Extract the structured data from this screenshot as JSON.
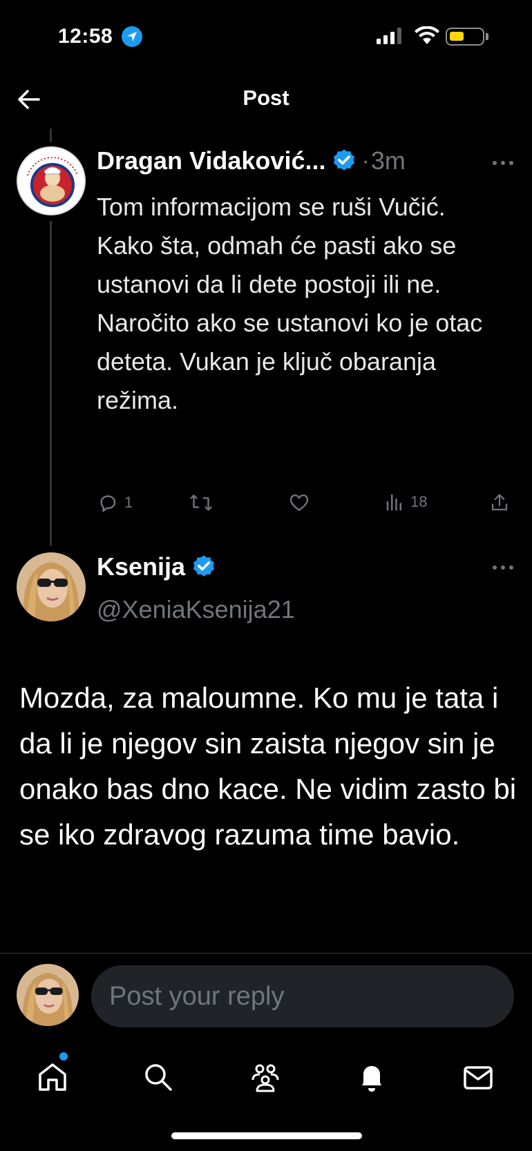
{
  "status_bar": {
    "time": "12:58"
  },
  "header": {
    "title": "Post"
  },
  "parent_post": {
    "author_name": "Dragan Vidaković...",
    "separator": "·",
    "time_ago": "3m",
    "text": "Tom informacijom se ruši Vučić. Kako šta, odmah će pasti ako se ustanovi da li dete postoji ili ne. Naročito ako se ustanovi ko je otac deteta. Vukan je ključ obaranja režima.",
    "reply_count": "1",
    "views_count": "18"
  },
  "main_post": {
    "author_name": "Ksenija",
    "handle": "@XeniaKsenija21",
    "text": "Mozda, za maloumne. Ko mu je tata i da li je njegov sin zaista njegov sin je onako bas dno kace. Ne vidim zasto bi se iko zdravog razuma time bavio."
  },
  "reply": {
    "placeholder": "Post your reply"
  },
  "colors": {
    "background": "#000000",
    "accent": "#1d9bf0",
    "muted": "#71767b",
    "input_bg": "#202327"
  },
  "icons": [
    "back-arrow-icon",
    "verified-badge-icon",
    "more-icon",
    "reply-icon",
    "repost-icon",
    "like-icon",
    "views-icon",
    "share-icon",
    "home-icon",
    "search-icon",
    "communities-icon",
    "notifications-icon",
    "messages-icon"
  ]
}
